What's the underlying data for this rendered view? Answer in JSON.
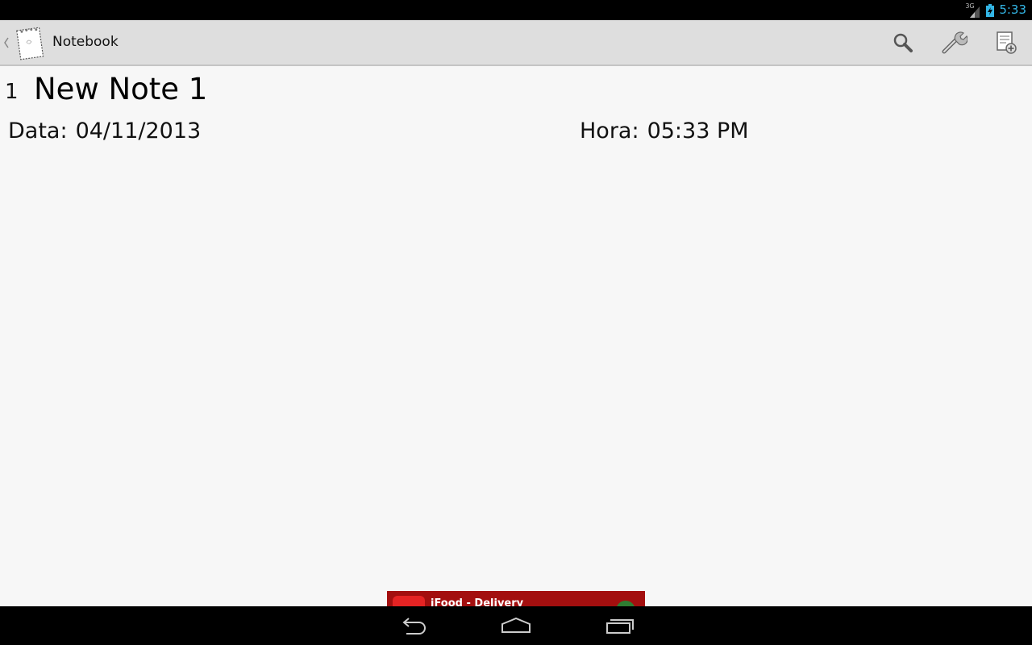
{
  "status_bar": {
    "network_label": "3G",
    "time": "5:33",
    "clock_color": "#33b5e5",
    "icons": [
      "signal-icon",
      "battery-charging-icon"
    ]
  },
  "action_bar": {
    "title": "Notebook",
    "icons": [
      "up-caret-icon",
      "notebook-logo-icon",
      "search-icon",
      "wrench-icon",
      "new-note-icon"
    ]
  },
  "note": {
    "number": "1",
    "title": "New Note 1",
    "date_label": "Data:",
    "date_value": "04/11/2013",
    "time_label": "Hora:",
    "time_value": "05:33 PM"
  },
  "ad": {
    "text": "iFood - Delivery",
    "background_color": "#a30f0f"
  },
  "nav_bar": {
    "icons": [
      "back-icon",
      "home-icon",
      "recent-apps-icon"
    ]
  }
}
